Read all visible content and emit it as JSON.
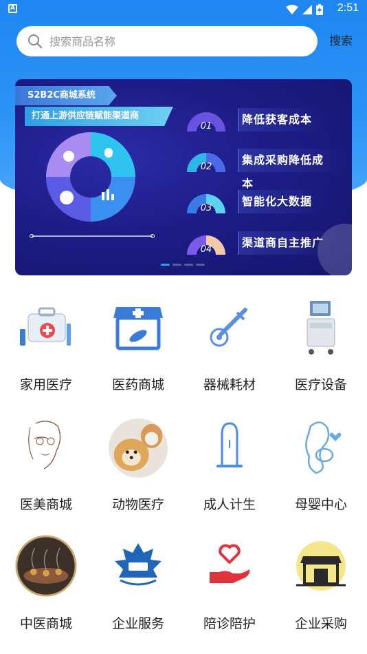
{
  "status_bar": {
    "time": "2:51"
  },
  "search": {
    "placeholder": "搜索商品名称",
    "value": "",
    "button_label": "搜索"
  },
  "banner": {
    "tag_title": "S2B2C商城系统",
    "tag_subtitle": "打通上游供应链赋能渠道商",
    "items": [
      {
        "num": "01",
        "label": "降低获客成本"
      },
      {
        "num": "02",
        "label": "集成采购降低成本"
      },
      {
        "num": "03",
        "label": "智能化大数据"
      },
      {
        "num": "04",
        "label": "渠道商自主推广"
      }
    ],
    "page_count": 4,
    "active_page": 1
  },
  "categories": [
    {
      "label": "家用医疗",
      "icon": "medical-kit-icon"
    },
    {
      "label": "医药商城",
      "icon": "pharmacy-store-icon"
    },
    {
      "label": "器械耗材",
      "icon": "dropper-icon"
    },
    {
      "label": "医疗设备",
      "icon": "medical-equipment-icon"
    },
    {
      "label": "医美商城",
      "icon": "beauty-face-icon"
    },
    {
      "label": "动物医疗",
      "icon": "pets-icon"
    },
    {
      "label": "成人计生",
      "icon": "condom-icon"
    },
    {
      "label": "母婴中心",
      "icon": "mother-baby-icon"
    },
    {
      "label": "中医商城",
      "icon": "moxibustion-icon"
    },
    {
      "label": "企业服务",
      "icon": "enterprise-maple-icon"
    },
    {
      "label": "陪诊陪护",
      "icon": "hand-heart-icon"
    },
    {
      "label": "企业采购",
      "icon": "storefront-icon"
    }
  ],
  "colors": {
    "primary": "#1f86f2",
    "banner_bg": "#1d1c86",
    "accent_blue": "#2f9bf0"
  }
}
